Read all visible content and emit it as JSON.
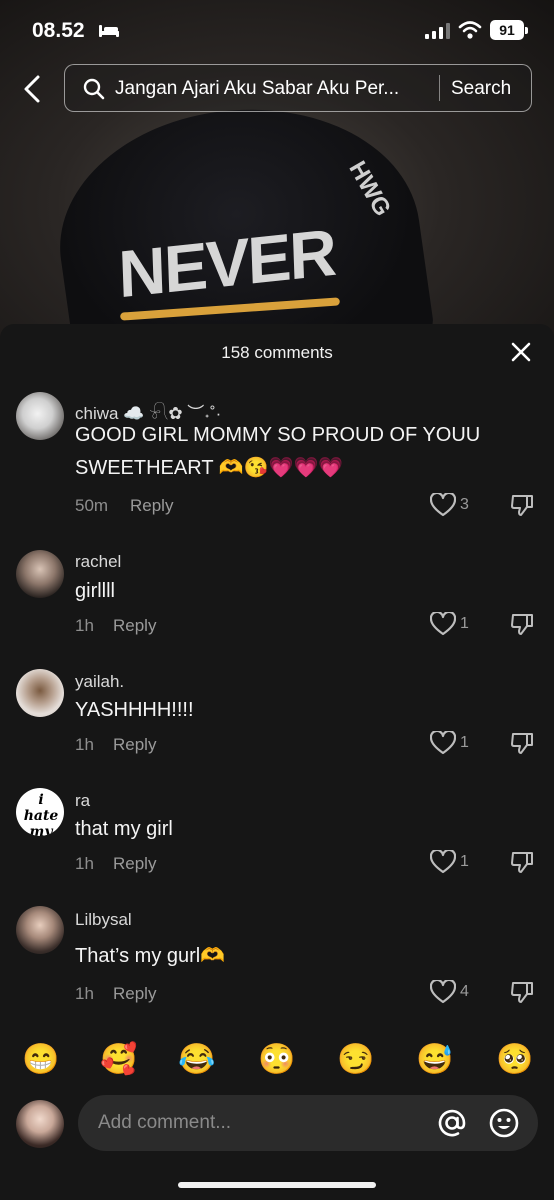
{
  "status_bar": {
    "time": "08.52",
    "battery": "91"
  },
  "search": {
    "query": "Jangan Ajari Aku Sabar Aku Per...",
    "button_label": "Search"
  },
  "video_overlay": {
    "cap_text": "NEVER",
    "cap_text_side": "HWG"
  },
  "comments_sheet": {
    "title": "158 comments",
    "comments": [
      {
        "username": "chiwa ☁️ 𓍯✿ ︶˖˚·",
        "text": "GOOD GIRL MOMMY SO PROUD OF YOUU SWEETHEART 🫶😘💗💗💗",
        "time": "50m",
        "reply_label": "Reply",
        "likes": "3"
      },
      {
        "username": "rachel",
        "text": "girllll",
        "time": "1h",
        "reply_label": "Reply",
        "likes": "1"
      },
      {
        "username": "yailah.",
        "text": "YASHHHH!!!!",
        "time": "1h",
        "reply_label": "Reply",
        "likes": "1"
      },
      {
        "username": "ra",
        "text": "that my girl",
        "time": "1h",
        "reply_label": "Reply",
        "likes": "1",
        "avatar_text": "i hate my life"
      },
      {
        "username": "Lilbysal",
        "text": "That’s my gurl🫶",
        "time": "1h",
        "reply_label": "Reply",
        "likes": "4"
      }
    ],
    "quick_emojis": [
      "😁",
      "🥰",
      "😂",
      "😳",
      "😏",
      "😅",
      "🥺"
    ],
    "composer": {
      "placeholder": "Add comment..."
    }
  },
  "colors": {
    "sheet_bg": "#161616",
    "muted_text": "#8e8e8e",
    "input_bg": "#2b2b2b"
  }
}
